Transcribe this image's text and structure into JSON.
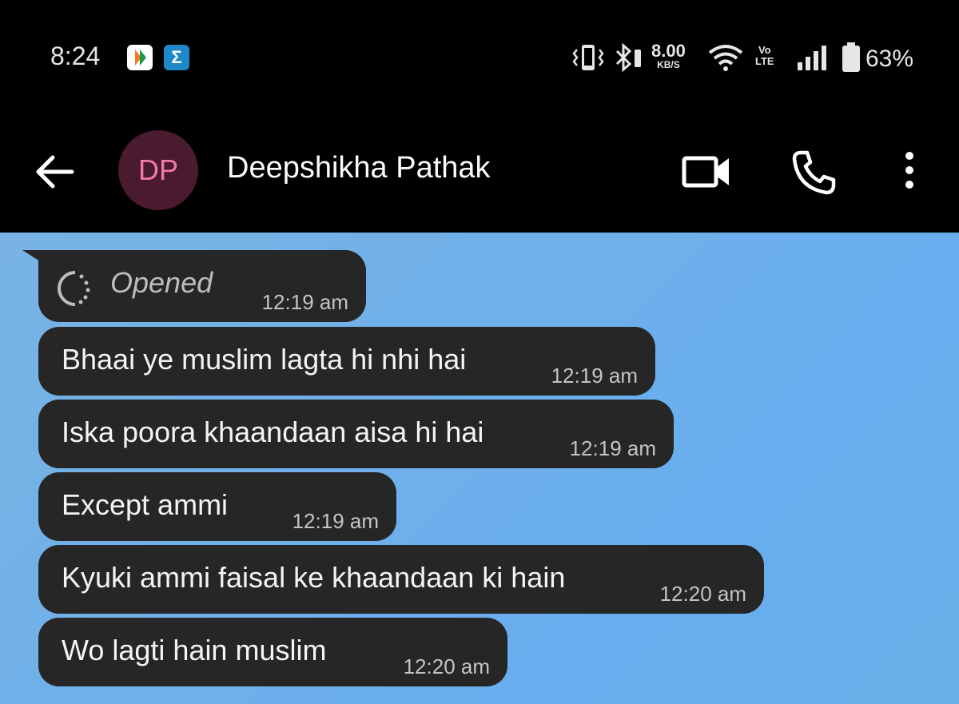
{
  "status_bar": {
    "time": "8:24",
    "net_speed_value": "8.00",
    "net_speed_unit": "KB/S",
    "volte_top": "Vo",
    "volte_bottom": "LTE",
    "battery": "63%",
    "notification_icons": [
      "bhim-icon",
      "sigma-icon"
    ],
    "system_icons": [
      "vibrate-icon",
      "bluetooth-icon",
      "wifi-icon",
      "signal-icon",
      "battery-icon"
    ]
  },
  "header": {
    "avatar_initials": "DP",
    "contact_name": "Deepshikha Pathak",
    "actions": [
      "back-arrow-icon",
      "video-call-icon",
      "phone-call-icon",
      "more-vert-icon"
    ]
  },
  "messages": [
    {
      "type": "status",
      "text": "Opened",
      "time": "12:19 am"
    },
    {
      "type": "text",
      "text": "Bhaai ye muslim lagta hi nhi hai",
      "time": "12:19 am"
    },
    {
      "type": "text",
      "text": "Iska poora khaandaan aisa hi hai",
      "time": "12:19 am"
    },
    {
      "type": "text",
      "text": "Except ammi",
      "time": "12:19 am"
    },
    {
      "type": "text",
      "text": "Kyuki ammi faisal ke khaandaan ki hain",
      "time": "12:20 am"
    },
    {
      "type": "text",
      "text": "Wo lagti hain muslim",
      "time": "12:20 am"
    }
  ],
  "colors": {
    "status_bar_bg": "#000000",
    "app_bar_bg": "#000000",
    "bubble_bg": "#262626",
    "avatar_bg": "#4a1a2e",
    "avatar_text": "#f07aa8",
    "wallpaper": "#6fb0ea"
  }
}
